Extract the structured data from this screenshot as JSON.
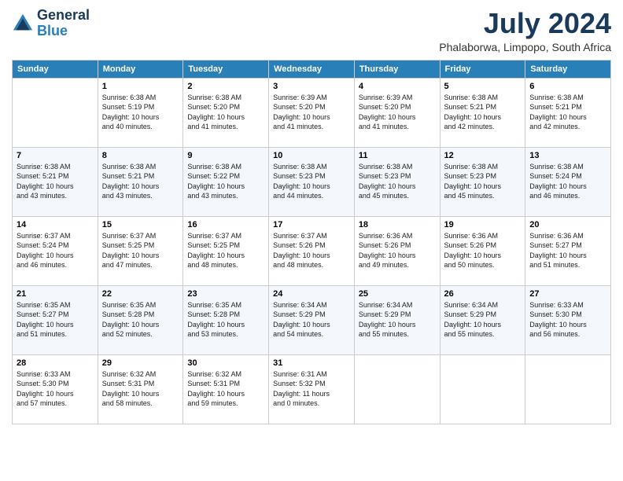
{
  "header": {
    "logo_line1": "General",
    "logo_line2": "Blue",
    "month_year": "July 2024",
    "location": "Phalaborwa, Limpopo, South Africa"
  },
  "weekdays": [
    "Sunday",
    "Monday",
    "Tuesday",
    "Wednesday",
    "Thursday",
    "Friday",
    "Saturday"
  ],
  "weeks": [
    [
      {
        "day": "",
        "info": ""
      },
      {
        "day": "1",
        "info": "Sunrise: 6:38 AM\nSunset: 5:19 PM\nDaylight: 10 hours\nand 40 minutes."
      },
      {
        "day": "2",
        "info": "Sunrise: 6:38 AM\nSunset: 5:20 PM\nDaylight: 10 hours\nand 41 minutes."
      },
      {
        "day": "3",
        "info": "Sunrise: 6:39 AM\nSunset: 5:20 PM\nDaylight: 10 hours\nand 41 minutes."
      },
      {
        "day": "4",
        "info": "Sunrise: 6:39 AM\nSunset: 5:20 PM\nDaylight: 10 hours\nand 41 minutes."
      },
      {
        "day": "5",
        "info": "Sunrise: 6:38 AM\nSunset: 5:21 PM\nDaylight: 10 hours\nand 42 minutes."
      },
      {
        "day": "6",
        "info": "Sunrise: 6:38 AM\nSunset: 5:21 PM\nDaylight: 10 hours\nand 42 minutes."
      }
    ],
    [
      {
        "day": "7",
        "info": "Sunrise: 6:38 AM\nSunset: 5:21 PM\nDaylight: 10 hours\nand 43 minutes."
      },
      {
        "day": "8",
        "info": "Sunrise: 6:38 AM\nSunset: 5:21 PM\nDaylight: 10 hours\nand 43 minutes."
      },
      {
        "day": "9",
        "info": "Sunrise: 6:38 AM\nSunset: 5:22 PM\nDaylight: 10 hours\nand 43 minutes."
      },
      {
        "day": "10",
        "info": "Sunrise: 6:38 AM\nSunset: 5:23 PM\nDaylight: 10 hours\nand 44 minutes."
      },
      {
        "day": "11",
        "info": "Sunrise: 6:38 AM\nSunset: 5:23 PM\nDaylight: 10 hours\nand 45 minutes."
      },
      {
        "day": "12",
        "info": "Sunrise: 6:38 AM\nSunset: 5:23 PM\nDaylight: 10 hours\nand 45 minutes."
      },
      {
        "day": "13",
        "info": "Sunrise: 6:38 AM\nSunset: 5:24 PM\nDaylight: 10 hours\nand 46 minutes."
      }
    ],
    [
      {
        "day": "14",
        "info": "Sunrise: 6:37 AM\nSunset: 5:24 PM\nDaylight: 10 hours\nand 46 minutes."
      },
      {
        "day": "15",
        "info": "Sunrise: 6:37 AM\nSunset: 5:25 PM\nDaylight: 10 hours\nand 47 minutes."
      },
      {
        "day": "16",
        "info": "Sunrise: 6:37 AM\nSunset: 5:25 PM\nDaylight: 10 hours\nand 48 minutes."
      },
      {
        "day": "17",
        "info": "Sunrise: 6:37 AM\nSunset: 5:26 PM\nDaylight: 10 hours\nand 48 minutes."
      },
      {
        "day": "18",
        "info": "Sunrise: 6:36 AM\nSunset: 5:26 PM\nDaylight: 10 hours\nand 49 minutes."
      },
      {
        "day": "19",
        "info": "Sunrise: 6:36 AM\nSunset: 5:26 PM\nDaylight: 10 hours\nand 50 minutes."
      },
      {
        "day": "20",
        "info": "Sunrise: 6:36 AM\nSunset: 5:27 PM\nDaylight: 10 hours\nand 51 minutes."
      }
    ],
    [
      {
        "day": "21",
        "info": "Sunrise: 6:35 AM\nSunset: 5:27 PM\nDaylight: 10 hours\nand 51 minutes."
      },
      {
        "day": "22",
        "info": "Sunrise: 6:35 AM\nSunset: 5:28 PM\nDaylight: 10 hours\nand 52 minutes."
      },
      {
        "day": "23",
        "info": "Sunrise: 6:35 AM\nSunset: 5:28 PM\nDaylight: 10 hours\nand 53 minutes."
      },
      {
        "day": "24",
        "info": "Sunrise: 6:34 AM\nSunset: 5:29 PM\nDaylight: 10 hours\nand 54 minutes."
      },
      {
        "day": "25",
        "info": "Sunrise: 6:34 AM\nSunset: 5:29 PM\nDaylight: 10 hours\nand 55 minutes."
      },
      {
        "day": "26",
        "info": "Sunrise: 6:34 AM\nSunset: 5:29 PM\nDaylight: 10 hours\nand 55 minutes."
      },
      {
        "day": "27",
        "info": "Sunrise: 6:33 AM\nSunset: 5:30 PM\nDaylight: 10 hours\nand 56 minutes."
      }
    ],
    [
      {
        "day": "28",
        "info": "Sunrise: 6:33 AM\nSunset: 5:30 PM\nDaylight: 10 hours\nand 57 minutes."
      },
      {
        "day": "29",
        "info": "Sunrise: 6:32 AM\nSunset: 5:31 PM\nDaylight: 10 hours\nand 58 minutes."
      },
      {
        "day": "30",
        "info": "Sunrise: 6:32 AM\nSunset: 5:31 PM\nDaylight: 10 hours\nand 59 minutes."
      },
      {
        "day": "31",
        "info": "Sunrise: 6:31 AM\nSunset: 5:32 PM\nDaylight: 11 hours\nand 0 minutes."
      },
      {
        "day": "",
        "info": ""
      },
      {
        "day": "",
        "info": ""
      },
      {
        "day": "",
        "info": ""
      }
    ]
  ]
}
